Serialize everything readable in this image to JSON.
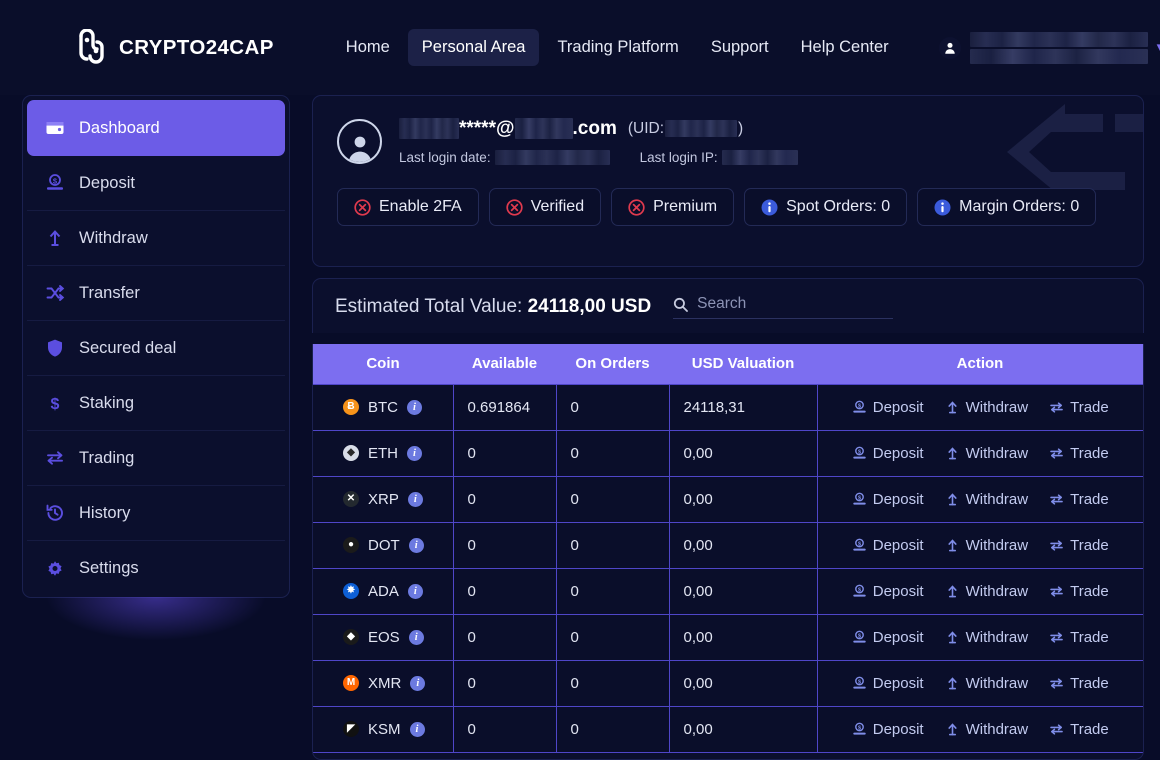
{
  "header": {
    "brand_name": "CRYPTO24CAP",
    "brand_logo_icon": "crypto24cap-logo-icon",
    "nav_links": [
      {
        "label": "Home",
        "active": false
      },
      {
        "label": "Personal Area",
        "active": true
      },
      {
        "label": "Trading Platform",
        "active": false
      },
      {
        "label": "Support",
        "active": false
      },
      {
        "label": "Help Center",
        "active": false
      }
    ],
    "user_menu": {
      "avatar_icon": "user-avatar-icon",
      "username_redacted": true,
      "caret_icon": "chevron-down-icon"
    }
  },
  "sidebar": {
    "items": [
      {
        "label": "Dashboard",
        "icon": "wallet-icon",
        "active": true
      },
      {
        "label": "Deposit",
        "icon": "deposit-icon",
        "active": false
      },
      {
        "label": "Withdraw",
        "icon": "withdraw-icon",
        "active": false
      },
      {
        "label": "Transfer",
        "icon": "transfer-icon",
        "active": false
      },
      {
        "label": "Secured deal",
        "icon": "shield-icon",
        "active": false
      },
      {
        "label": "Staking",
        "icon": "dollar-icon",
        "active": false
      },
      {
        "label": "Trading",
        "icon": "exchange-icon",
        "active": false
      },
      {
        "label": "History",
        "icon": "history-icon",
        "active": false
      },
      {
        "label": "Settings",
        "icon": "gear-icon",
        "active": false
      }
    ]
  },
  "profile": {
    "avatar_icon": "user-avatar-icon",
    "email_masked": "*****@",
    "email_tld": ".com",
    "uid_label_open": "(UID:",
    "uid_label_close": ")",
    "last_login_date_label": "Last login date:",
    "last_login_ip_label": "Last login IP:",
    "decoration_icon": "left-arrow-decoration-icon",
    "badges": [
      {
        "label": "Enable 2FA",
        "icon": "circle-x-icon",
        "icon_color": "#e03a4e"
      },
      {
        "label": "Verified",
        "icon": "circle-x-icon",
        "icon_color": "#e03a4e"
      },
      {
        "label": "Premium",
        "icon": "circle-x-icon",
        "icon_color": "#e03a4e"
      },
      {
        "label": "Spot Orders: 0",
        "icon": "info-icon",
        "icon_color": "#3b5bdb"
      },
      {
        "label": "Margin Orders: 0",
        "icon": "info-icon",
        "icon_color": "#3b5bdb"
      }
    ]
  },
  "balance": {
    "estimated_label": "Estimated Total Value:",
    "estimated_value": "24118,00 USD",
    "search_placeholder": "Search",
    "search_value": "",
    "search_icon": "search-icon"
  },
  "table": {
    "columns": [
      "Coin",
      "Available",
      "On Orders",
      "USD Valuation",
      "Action"
    ],
    "action_labels": {
      "deposit": "Deposit",
      "withdraw": "Withdraw",
      "trade": "Trade"
    },
    "rows": [
      {
        "coin": "BTC",
        "icon_color": "#f7931a",
        "icon_glyph": "Ƀ",
        "icon_text_color": "#ffffff",
        "available": "0.691864",
        "on_orders": "0",
        "usd_valuation": "24118,31"
      },
      {
        "coin": "ETH",
        "icon_color": "#d9dde8",
        "icon_glyph": "◆",
        "icon_text_color": "#2a2a2a",
        "available": "0",
        "on_orders": "0",
        "usd_valuation": "0,00"
      },
      {
        "coin": "XRP",
        "icon_color": "#23292f",
        "icon_glyph": "✕",
        "icon_text_color": "#ffffff",
        "available": "0",
        "on_orders": "0",
        "usd_valuation": "0,00"
      },
      {
        "coin": "DOT",
        "icon_color": "#1b1b1b",
        "icon_glyph": "●",
        "icon_text_color": "#ffffff",
        "available": "0",
        "on_orders": "0",
        "usd_valuation": "0,00"
      },
      {
        "coin": "ADA",
        "icon_color": "#0d5fd6",
        "icon_glyph": "✸",
        "icon_text_color": "#ffffff",
        "available": "0",
        "on_orders": "0",
        "usd_valuation": "0,00"
      },
      {
        "coin": "EOS",
        "icon_color": "#1a1a1a",
        "icon_glyph": "◆",
        "icon_text_color": "#ffffff",
        "available": "0",
        "on_orders": "0",
        "usd_valuation": "0,00"
      },
      {
        "coin": "XMR",
        "icon_color": "#ff6600",
        "icon_glyph": "M",
        "icon_text_color": "#ffffff",
        "available": "0",
        "on_orders": "0",
        "usd_valuation": "0,00"
      },
      {
        "coin": "KSM",
        "icon_color": "#111111",
        "icon_glyph": "◤",
        "icon_text_color": "#ffffff",
        "available": "0",
        "on_orders": "0",
        "usd_valuation": "0,00"
      }
    ]
  },
  "theme": {
    "bg": "#080c28",
    "panel": "#0b0f2d",
    "accent": "#6c5ce7",
    "table_header": "#7c6ef0",
    "border": "#1b2150",
    "grid": "#4f46c8",
    "danger": "#e03a4e",
    "info": "#3b5bdb"
  }
}
